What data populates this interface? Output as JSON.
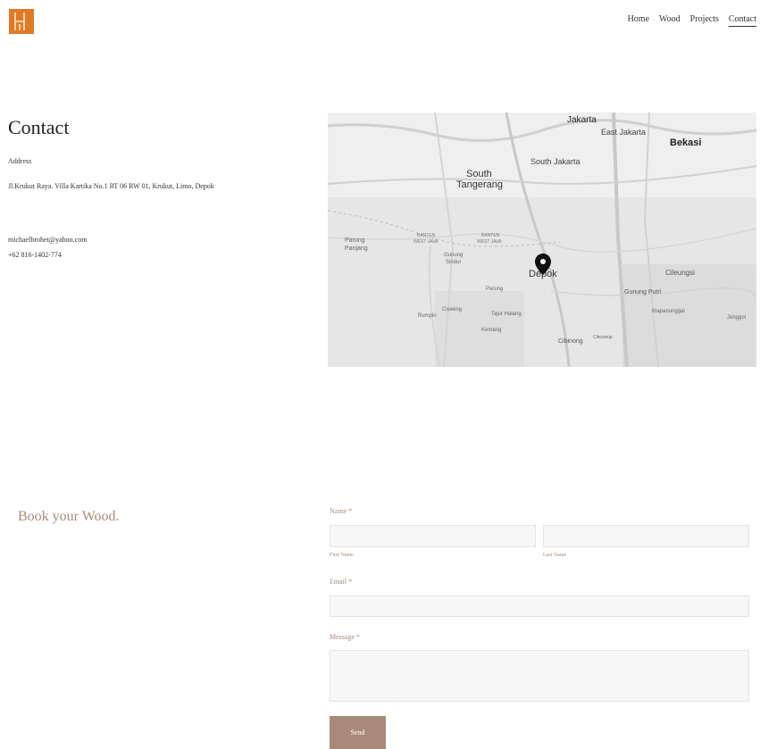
{
  "nav": {
    "items": [
      "Home",
      "Wood",
      "Projects",
      "Contact"
    ],
    "active": "Contact"
  },
  "contact": {
    "title": "Contact",
    "address_label": "Address",
    "address": "Jl.Krukut Raya. Villa Kartika No.1 RT 06 RW 01, Krukut, Limo, Depok",
    "email": "michaelbrohet@yahoo.com",
    "phone": "+62 816-1402-774"
  },
  "map": {
    "labels": {
      "jakarta": "Jakarta",
      "east_jakarta": "East Jakarta",
      "bekasi": "Bekasi",
      "south_tangerang_1": "South",
      "south_tangerang_2": "Tangerang",
      "south_jakarta": "South Jakarta",
      "parung_panjang_1": "Parung",
      "parung_panjang_2": "Panjang",
      "banten_west_java_1a": "BANTEN",
      "banten_west_java_1b": "WEST JAVA",
      "banten_west_java_2a": "BANTEN",
      "banten_west_java_2b": "WEST JAVA",
      "gunung_sindur_1": "Gunung",
      "gunung_sindur_2": "Sindur",
      "depok": "Depok",
      "cileungsi": "Cileungsi",
      "parung": "Parung",
      "gunung_putri": "Gunung Putri",
      "ciseeng": "Ciseeng",
      "rumpin": "Rumpin",
      "tajur_halang": "Tajur Halang",
      "klapanunggal": "Klapanunggal",
      "jonggol": "Jonggol",
      "kemang": "Kemang",
      "cibinong": "Cibinong",
      "citeureup": "Citeureup"
    }
  },
  "form": {
    "heading": "Book your Wood.",
    "name_label": "Name *",
    "first_name_label": "First Name",
    "last_name_label": "Last Name",
    "email_label": "Email *",
    "message_label": "Message *",
    "send_label": "Send"
  },
  "colors": {
    "accent": "#a88a78",
    "logo": "#e07b25"
  }
}
